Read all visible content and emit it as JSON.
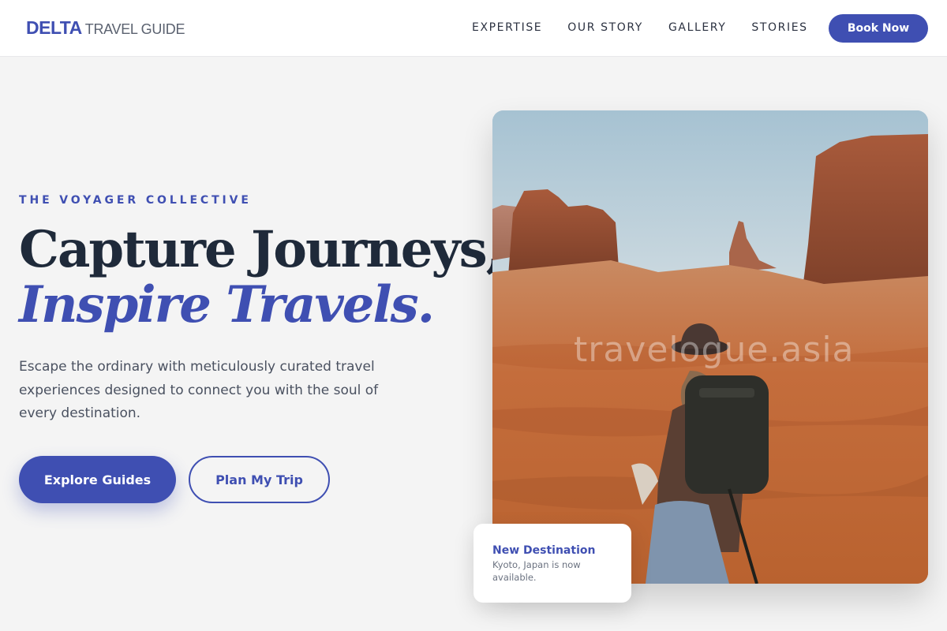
{
  "header": {
    "logo_mark": "DELTA",
    "logo_sub": "TRAVEL GUIDE",
    "nav": [
      {
        "label": "EXPERTISE"
      },
      {
        "label": "OUR STORY"
      },
      {
        "label": "GALLERY"
      },
      {
        "label": "STORIES"
      }
    ],
    "cta_label": "Book Now"
  },
  "hero": {
    "eyebrow": "THE VOYAGER COLLECTIVE",
    "headline_line1": "Capture Journeys,",
    "headline_line2": "Inspire Travels.",
    "description": "Escape the ordinary with meticulously curated travel experiences designed to connect you with the soul of every destination.",
    "primary_button": "Explore Guides",
    "secondary_button": "Plan My Trip"
  },
  "image": {
    "watermark": "travelogue.asia"
  },
  "card": {
    "title": "New Destination",
    "description": "Kyoto, Japan is now available."
  },
  "colors": {
    "accent": "#3f4fb2",
    "heading": "#1f2a3a",
    "body_text": "#4a5160",
    "background": "#f4f4f4"
  },
  "icons": [
    "desert-landscape-photo"
  ]
}
